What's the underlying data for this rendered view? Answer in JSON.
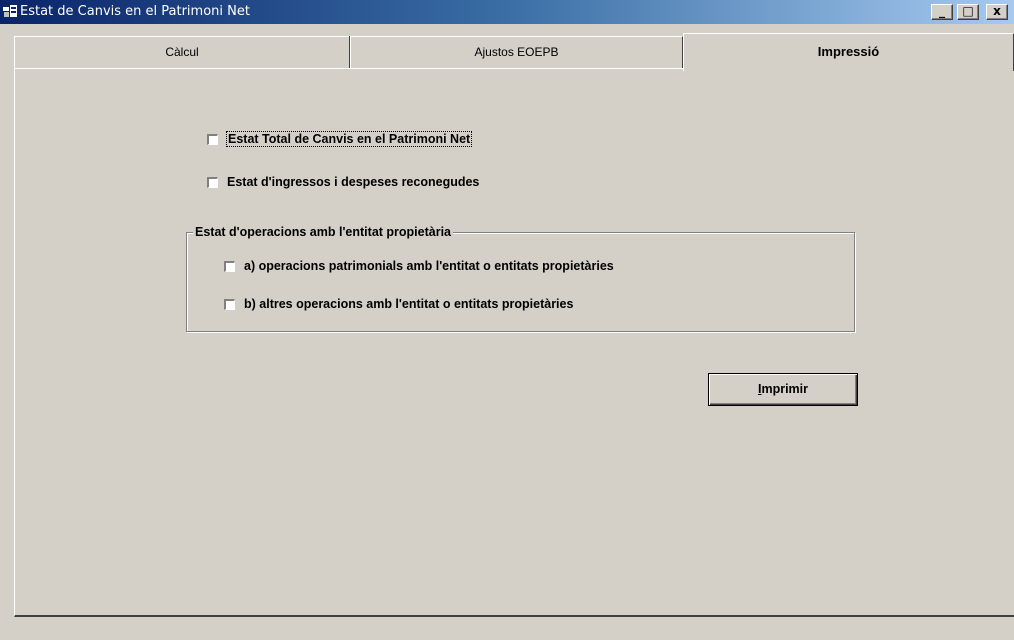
{
  "window": {
    "title": "Estat de Canvis en el Patrimoni Net",
    "controls": {
      "minimize": "_",
      "maximize": "□",
      "close": "x"
    }
  },
  "tabs": [
    {
      "label": "Càlcul",
      "active": false
    },
    {
      "label": "Ajustos EOEPB",
      "active": false
    },
    {
      "label": "Impressió",
      "active": true
    }
  ],
  "print_options": {
    "total_changes": {
      "label": "Estat Total de Canvis en el Patrimoni Net",
      "checked": false
    },
    "recognized_income": {
      "label": "Estat d'ingressos i despeses reconegudes",
      "checked": false
    }
  },
  "owner_group": {
    "title": "Estat d'operacions amb l'entitat propietària",
    "option_a": {
      "label": "a) operacions patrimonials amb l'entitat o entitats propietàries",
      "checked": false
    },
    "option_b": {
      "label": "b) altres operacions amb l'entitat o entitats propietàries",
      "checked": false
    }
  },
  "print_button": {
    "mnemonic": "I",
    "rest": "mprimir"
  }
}
